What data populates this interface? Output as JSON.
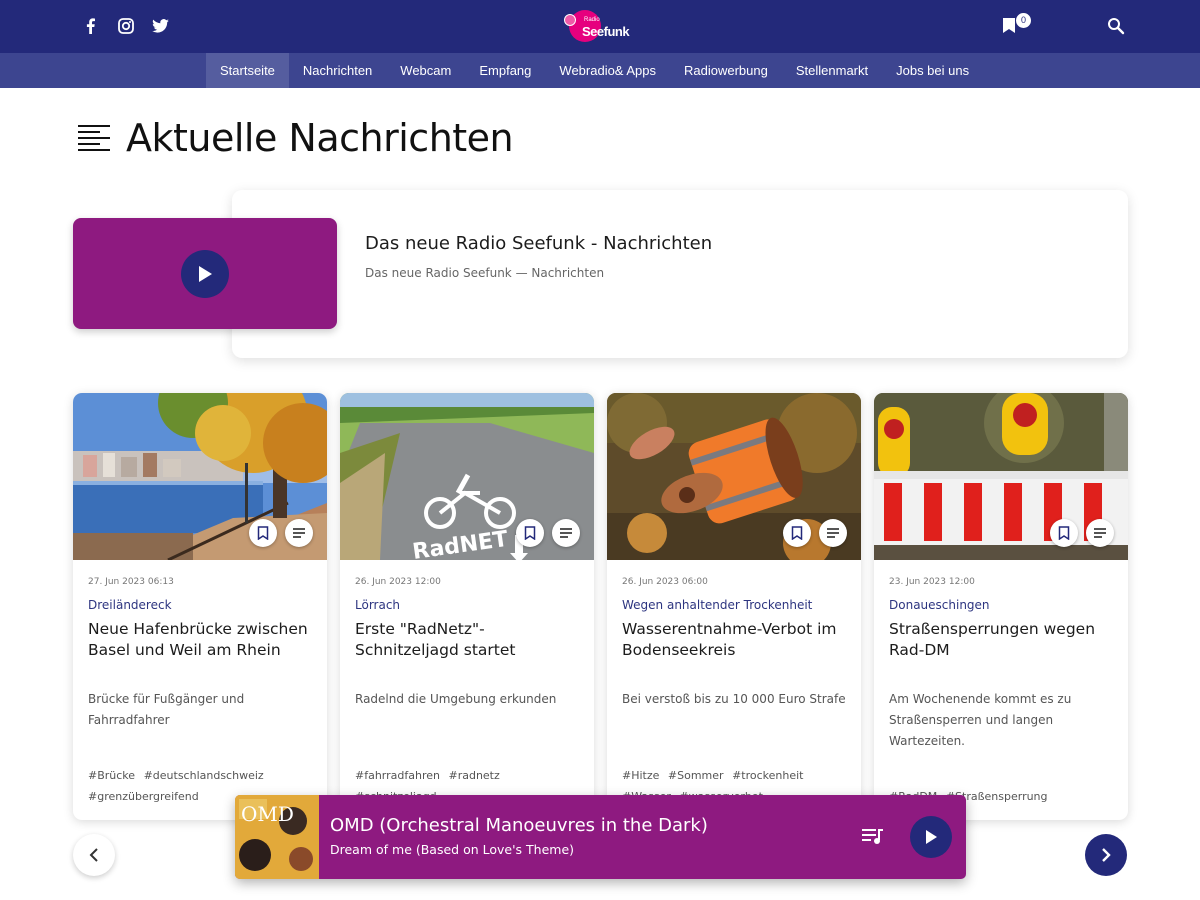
{
  "brand": {
    "radio": "Radio",
    "name": "Seefunk"
  },
  "header": {
    "bookmark_count": "0"
  },
  "nav": [
    {
      "label": "Startseite"
    },
    {
      "label": "Nachrichten"
    },
    {
      "label": "Webcam"
    },
    {
      "label": "Empfang"
    },
    {
      "label": "Webradio& Apps"
    },
    {
      "label": "Radiowerbung"
    },
    {
      "label": "Stellenmarkt"
    },
    {
      "label": "Jobs bei uns"
    }
  ],
  "page": {
    "title": "Aktuelle Nachrichten"
  },
  "featured": {
    "title": "Das neue Radio Seefunk - Nachrichten",
    "subtitle": "Das neue Radio Seefunk — Nachrichten"
  },
  "articles": [
    {
      "date": "27. Jun 2023 06:13",
      "kicker": "Dreiländereck",
      "title": "Neue Hafenbrücke zwischen Basel und Weil am Rhein",
      "teaser": "Brücke für Fußgänger und Fahrradfahrer",
      "tags": [
        "#Brücke",
        "#deutschlandschweiz",
        "#grenzübergreifend"
      ]
    },
    {
      "date": "26. Jun 2023 12:00",
      "kicker": "Lörrach",
      "title": "Erste \"RadNetz\"-Schnitzeljagd startet",
      "teaser": "Radelnd die Umgebung erkunden",
      "tags": [
        "#fahrradfahren",
        "#radnetz",
        "#schnitzeljagd"
      ]
    },
    {
      "date": "26. Jun 2023 06:00",
      "kicker": "Wegen anhaltender Trockenheit",
      "title": "Wasserentnahme-Verbot im Bodenseekreis",
      "teaser": "Bei verstoß bis zu 10 000 Euro Strafe",
      "tags": [
        "#Hitze",
        "#Sommer",
        "#trockenheit",
        "#Wasser",
        "#wasserverbot"
      ]
    },
    {
      "date": "23. Jun 2023 12:00",
      "kicker": "Donaueschingen",
      "title": "Straßensperrungen wegen Rad-DM",
      "teaser": "Am Wochenende kommt es zu Straßensperren und langen Wartezeiten.",
      "tags": [
        "#RadDM",
        "#Straßensperrung"
      ]
    }
  ],
  "player": {
    "artist": "OMD (Orchestral Manoeuvres in the Dark)",
    "song": "Dream of me (Based on Love's Theme)",
    "cover_text": "OMD"
  },
  "colors": {
    "navy": "#23297a",
    "nav": "#3d4590",
    "magenta": "#8e1a80"
  }
}
